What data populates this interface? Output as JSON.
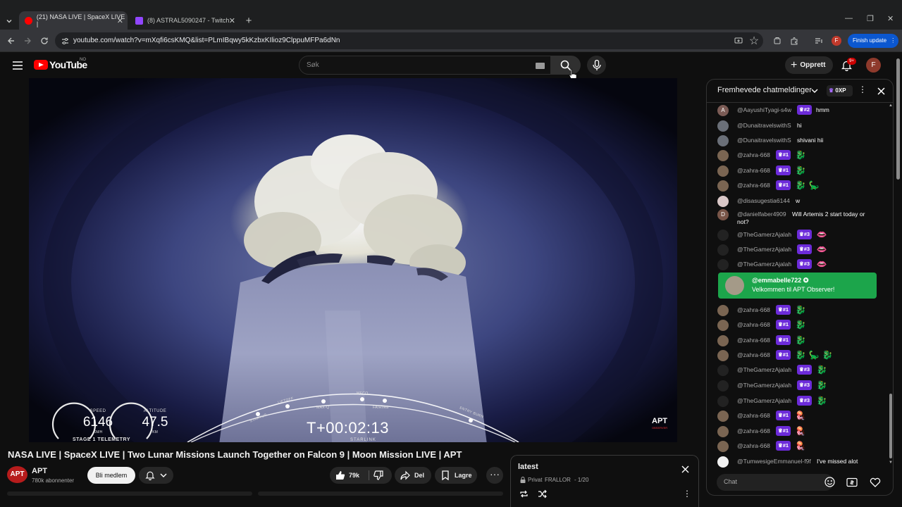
{
  "browser": {
    "tabs": [
      {
        "title": "(21) NASA LIVE | SpaceX LIVE |",
        "favicon_color": "#ff0000",
        "active": true
      },
      {
        "title": "(8) ASTRAL5090247 - Twitch",
        "favicon_color": "#9146ff",
        "active": false
      }
    ],
    "url": "youtube.com/watch?v=mXqfi6csKMQ&list=PLmIBqwy5kKzbxKIlioz9ClppuMFPa6dNn",
    "profile_initial": "F",
    "finish_update_label": "Finish update"
  },
  "header": {
    "logo_text": "YouTube",
    "country_code": "NO",
    "search_placeholder": "Søk",
    "create_label": "Opprett",
    "notification_count": "9+",
    "avatar_initial": "F"
  },
  "video": {
    "speed_label": "SPEED",
    "speed_value": "6146",
    "speed_unit": "KM/H",
    "altitude_label": "ALTITUDE",
    "altitude_value": "47.5",
    "altitude_unit": "KM",
    "stage_label": "STAGE 1 TELEMETRY",
    "timer": "T+00:02:13",
    "mission": "STARLINK",
    "events": [
      "STARTUP",
      "LIFTOFF",
      "MAX-Q",
      "MECO",
      "FAIRING",
      "ENTRY BURN"
    ],
    "watermark": "APT",
    "watermark_sub": "OBSERVER"
  },
  "info": {
    "title": "NASA LIVE | SpaceX LIVE | Two Lunar Missions Launch Together on Falcon 9 | Moon Mission LIVE | APT",
    "channel_name": "APT",
    "channel_logo_text": "APT",
    "subscribers": "780k abonnenter",
    "join_label": "Bli medlem",
    "likes": "79k",
    "share_label": "Del",
    "save_label": "Lagre"
  },
  "playlist": {
    "title": "latest",
    "privacy": "Privat",
    "owner": "FRALLOR",
    "position": "- 1/20"
  },
  "chat": {
    "title": "Fremhevede chatmeldinger",
    "xp_label": "0XP",
    "input_placeholder": "Chat",
    "welcome": {
      "name": "@emmabelle722",
      "text": "Velkommen til APT Observer!"
    },
    "messages": [
      {
        "author": "@AayushiTyagi-s4w",
        "badge": "#2",
        "text": "hmm",
        "emoji": "",
        "avatar_letter": "A",
        "avatar_color": "#7b5b55"
      },
      {
        "author": "@DunaitravelswithS",
        "badge": "",
        "text": "hi",
        "emoji": "",
        "avatar_letter": "",
        "avatar_color": "#6a6f78"
      },
      {
        "author": "@DunaitravelswithS",
        "badge": "",
        "text": "shivani hii",
        "emoji": "",
        "avatar_letter": "",
        "avatar_color": "#6a6f78"
      },
      {
        "author": "@zahra-668",
        "badge": "#1",
        "text": "",
        "emoji": "🐉",
        "avatar_letter": "",
        "avatar_color": "#7a6552"
      },
      {
        "author": "@zahra-668",
        "badge": "#1",
        "text": "",
        "emoji": "🐉",
        "avatar_letter": "",
        "avatar_color": "#7a6552"
      },
      {
        "author": "@zahra-668",
        "badge": "#1",
        "text": "",
        "emoji": "🐉🦕",
        "avatar_letter": "",
        "avatar_color": "#7a6552"
      },
      {
        "author": "@disasugestia6144",
        "badge": "",
        "text": "w",
        "emoji": "",
        "avatar_letter": "",
        "avatar_color": "#d9c7c7"
      },
      {
        "author": "@danielfaber4909",
        "badge": "",
        "text": "Will Artemis 2 start today or",
        "text2": "not?",
        "emoji": "",
        "avatar_letter": "D",
        "avatar_color": "#795548"
      },
      {
        "author": "@TheGamerzAjalah",
        "badge": "#3",
        "text": "",
        "emoji": "👄",
        "avatar_letter": "",
        "avatar_color": "#222222"
      },
      {
        "author": "@TheGamerzAjalah",
        "badge": "#3",
        "text": "",
        "emoji": "👄",
        "avatar_letter": "",
        "avatar_color": "#222222"
      },
      {
        "author": "@TheGamerzAjalah",
        "badge": "#3",
        "text": "",
        "emoji": "👄",
        "avatar_letter": "",
        "avatar_color": "#222222"
      },
      {
        "author": "@zahra-668",
        "badge": "#1",
        "text": "",
        "emoji": "🐉",
        "avatar_letter": "",
        "avatar_color": "#7a6552"
      },
      {
        "author": "@zahra-668",
        "badge": "#1",
        "text": "",
        "emoji": "🐉",
        "avatar_letter": "",
        "avatar_color": "#7a6552"
      },
      {
        "author": "@zahra-668",
        "badge": "#1",
        "text": "",
        "emoji": "🐉",
        "avatar_letter": "",
        "avatar_color": "#7a6552"
      },
      {
        "author": "@zahra-668",
        "badge": "#1",
        "text": "",
        "emoji": "🐉🦕🐉",
        "avatar_letter": "",
        "avatar_color": "#7a6552"
      },
      {
        "author": "@TheGamerzAjalah",
        "badge": "#3",
        "text": "",
        "emoji": "🐉",
        "avatar_letter": "",
        "avatar_color": "#222222"
      },
      {
        "author": "@TheGamerzAjalah",
        "badge": "#3",
        "text": "",
        "emoji": "🐉",
        "avatar_letter": "",
        "avatar_color": "#222222"
      },
      {
        "author": "@TheGamerzAjalah",
        "badge": "#3",
        "text": "",
        "emoji": "🐉",
        "avatar_letter": "",
        "avatar_color": "#222222"
      },
      {
        "author": "@zahra-668",
        "badge": "#1",
        "text": "",
        "emoji": "🪼",
        "avatar_letter": "",
        "avatar_color": "#7a6552"
      },
      {
        "author": "@zahra-668",
        "badge": "#1",
        "text": "",
        "emoji": "🪼",
        "avatar_letter": "",
        "avatar_color": "#7a6552"
      },
      {
        "author": "@zahra-668",
        "badge": "#1",
        "text": "",
        "emoji": "🪼",
        "avatar_letter": "",
        "avatar_color": "#7a6552"
      },
      {
        "author": "@TumwesigeEmmanuel-f9f",
        "badge": "",
        "text": "I've missed alot",
        "emoji": "",
        "avatar_letter": "",
        "avatar_color": "#f1f1f1"
      }
    ]
  },
  "colors": {
    "accent_red": "#ff0000",
    "member_badge": "#6c2bd9",
    "welcome_green": "#1ca54b",
    "update_blue": "#0b57d0"
  }
}
